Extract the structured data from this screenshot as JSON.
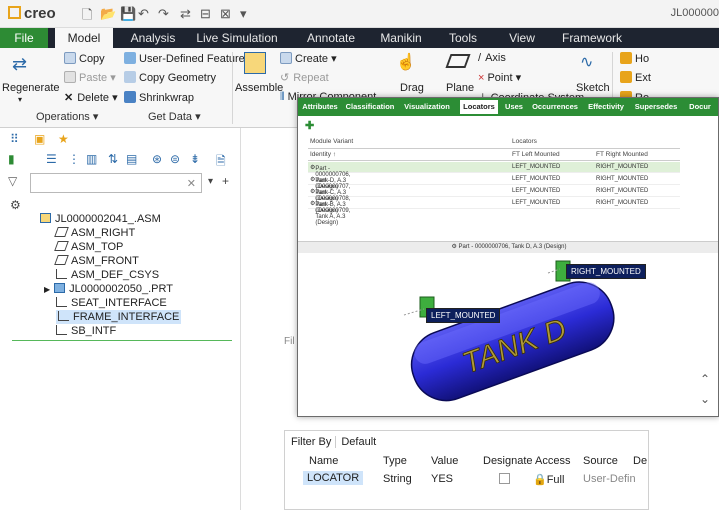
{
  "titlebar": {
    "app_name": "creo",
    "right_text": "JL000000"
  },
  "tabs": [
    "File",
    "Model",
    "Analysis",
    "Live Simulation",
    "Annotate",
    "Manikin",
    "Tools",
    "View",
    "Framework"
  ],
  "ribbon": {
    "regenerate": "Regenerate",
    "copy": "Copy",
    "paste": "Paste",
    "delete": "Delete",
    "udf": "User-Defined Feature",
    "copy_geometry": "Copy Geometry",
    "shrinkwrap": "Shrinkwrap",
    "assemble": "Assemble",
    "create": "Create",
    "repeat": "Repeat",
    "mirror": "Mirror Component",
    "drag": "Drag",
    "plane": "Plane",
    "axis": "Axis",
    "point": "Point",
    "coord": "Coordinate System",
    "sketch": "Sketch",
    "ho": "Ho",
    "ext": "Ext",
    "re": "Re",
    "group_operations": "Operations",
    "group_getdata": "Get Data"
  },
  "tree": {
    "items": [
      {
        "label": "JL0000002041_.ASM",
        "icon": "assembly-icon"
      },
      {
        "label": "ASM_RIGHT",
        "icon": "datum-plane-icon"
      },
      {
        "label": "ASM_TOP",
        "icon": "datum-plane-icon"
      },
      {
        "label": "ASM_FRONT",
        "icon": "datum-plane-icon"
      },
      {
        "label": "ASM_DEF_CSYS",
        "icon": "csys-icon"
      },
      {
        "label": "JL0000002050_.PRT",
        "icon": "part-icon"
      },
      {
        "label": "SEAT_INTERFACE",
        "icon": "csys-icon"
      },
      {
        "label": "FRAME_INTERFACE",
        "icon": "csys-icon"
      },
      {
        "label": "SB_INTF",
        "icon": "csys-icon"
      }
    ]
  },
  "side_label": "Fil",
  "props": {
    "filter_by": "Filter By",
    "filter_default": "Default",
    "headers": [
      "Name",
      "Type",
      "Value",
      "Designate",
      "Access",
      "Source",
      "De"
    ],
    "row": {
      "name": "LOCATOR",
      "type": "String",
      "value": "YES",
      "access": "Full",
      "source": "User-Defin"
    }
  },
  "overlay": {
    "tabs": [
      "Attributes",
      "Classification",
      "Visualization",
      "Locators",
      "Uses",
      "Occurrences",
      "Effectivity",
      "Supersedes",
      "Docur"
    ],
    "grid": {
      "header_module": "Module Variant",
      "header_locators": "Locators",
      "col_identity": "Identity",
      "col_left": "FT Left Mounted",
      "col_right": "FT Right Mounted",
      "rows": [
        {
          "identity": "Part - 0000000706, Tank D, A.3 (Design)",
          "left": "LEFT_MOUNTED",
          "right": "RIGHT_MOUNTED"
        },
        {
          "identity": "Part - 0000000707, Tank C, A.3 (Design)",
          "left": "LEFT_MOUNTED",
          "right": "RIGHT_MOUNTED"
        },
        {
          "identity": "Part - 0000000708, Tank B, A.3 (Design)",
          "left": "LEFT_MOUNTED",
          "right": "RIGHT_MOUNTED"
        },
        {
          "identity": "Part - 0000000709, Tank A, A.3 (Design)",
          "left": "LEFT_MOUNTED",
          "right": "RIGHT_MOUNTED"
        }
      ]
    },
    "viewer_title": "Part - 0000000706, Tank D, A.3 (Design)",
    "label_right": "RIGHT_MOUNTED",
    "label_left": "LEFT_MOUNTED",
    "tank_text": "TANK D"
  },
  "colors": {
    "ribbon_dark": "#1e2430",
    "file_green": "#2d8b34",
    "overlay_green": "#2c8d35",
    "tank_blue": "#2b2bd6",
    "label_navy": "#0d1f5c"
  }
}
